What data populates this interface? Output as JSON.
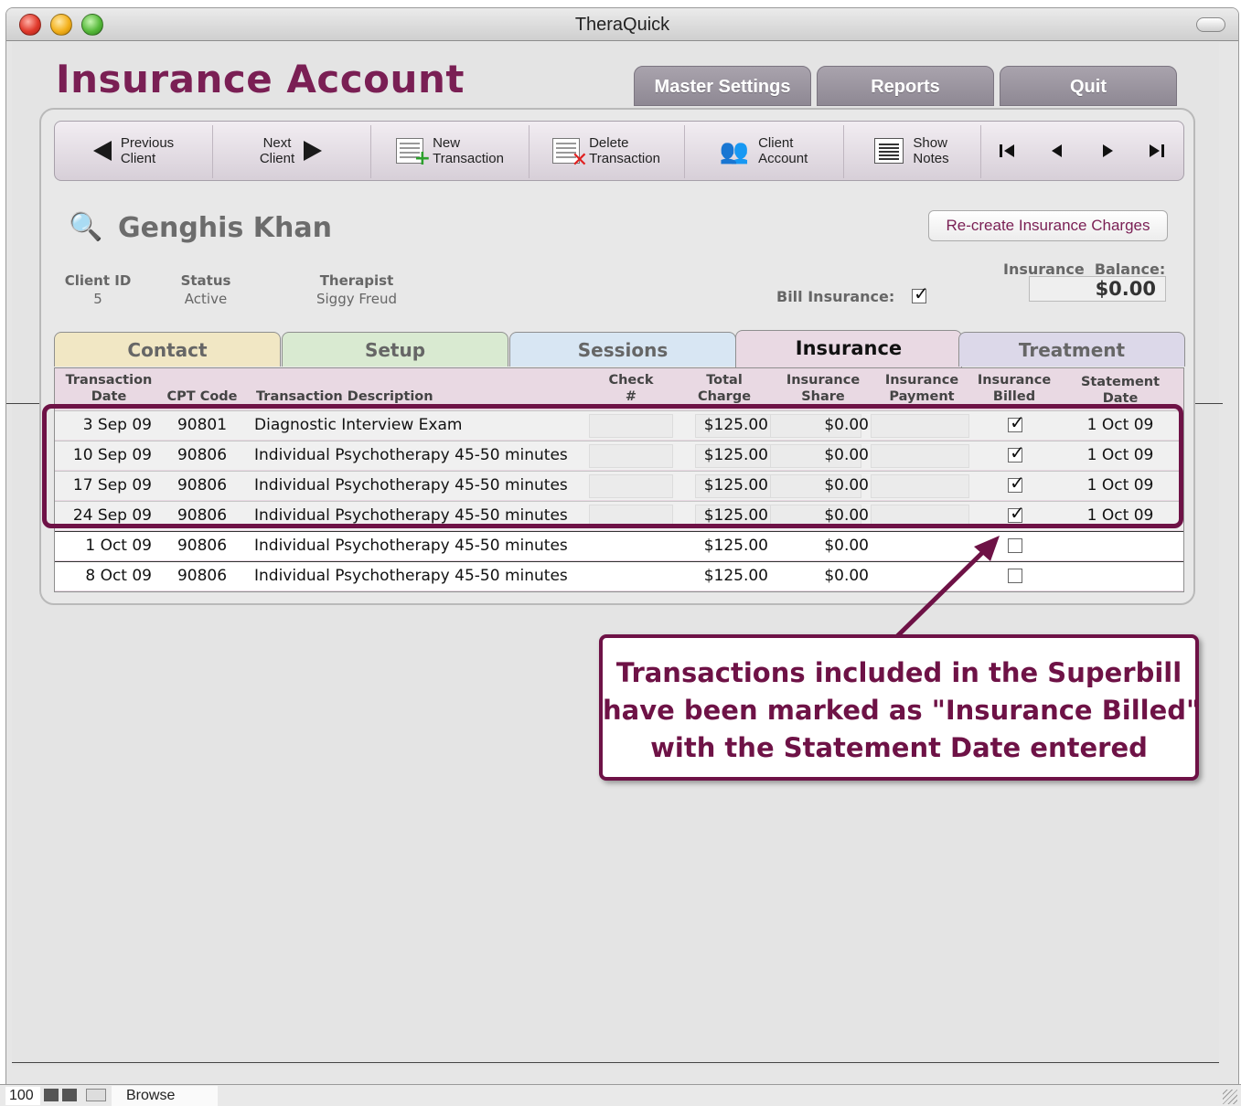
{
  "window": {
    "title": "TheraQuick"
  },
  "header": {
    "title": "Insurance Account"
  },
  "top_tabs": [
    {
      "label": "Master Settings"
    },
    {
      "label": "Reports"
    },
    {
      "label": "Quit"
    }
  ],
  "toolbar": {
    "previous_client": "Previous\nClient",
    "next_client": "Next\nClient",
    "new_transaction": "New\nTransaction",
    "delete_transaction": "Delete\nTransaction",
    "client_account": "Client\nAccount",
    "show_notes": "Show\nNotes"
  },
  "client": {
    "name": "Genghis Khan",
    "id_label": "Client ID",
    "id": "5",
    "status_label": "Status",
    "status": "Active",
    "therapist_label": "Therapist",
    "therapist": "Siggy Freud",
    "bill_insurance_label": "Bill Insurance:",
    "bill_insurance": true,
    "balance_label": "Insurance  Balance:",
    "balance": "$0.00",
    "recreate_button": "Re-create Insurance Charges"
  },
  "tabs": [
    {
      "label": "Contact",
      "color": "#f1e7c4"
    },
    {
      "label": "Setup",
      "color": "#d9ead1"
    },
    {
      "label": "Sessions",
      "color": "#d8e6f3"
    },
    {
      "label": "Insurance",
      "color": "#e9d9e3",
      "active": true
    },
    {
      "label": "Treatment",
      "color": "#dcd8e9"
    }
  ],
  "table": {
    "headers": {
      "date": "Transaction\nDate",
      "cpt": "CPT Code",
      "desc": "Transaction Description",
      "check": "Check\n#",
      "total": "Total\nCharge",
      "share": "Insurance\nShare",
      "payment": "Insurance\nPayment",
      "billed": "Insurance\nBilled",
      "stmt": "Statement\nDate"
    },
    "rows": [
      {
        "date": "3 Sep 09",
        "cpt": "90801",
        "desc": "Diagnostic Interview Exam",
        "total": "$125.00",
        "share": "$0.00",
        "billed": true,
        "stmt": "1 Oct 09"
      },
      {
        "date": "10 Sep 09",
        "cpt": "90806",
        "desc": "Individual Psychotherapy 45-50 minutes",
        "total": "$125.00",
        "share": "$0.00",
        "billed": true,
        "stmt": "1 Oct 09"
      },
      {
        "date": "17 Sep 09",
        "cpt": "90806",
        "desc": "Individual Psychotherapy 45-50 minutes",
        "total": "$125.00",
        "share": "$0.00",
        "billed": true,
        "stmt": "1 Oct 09"
      },
      {
        "date": "24 Sep 09",
        "cpt": "90806",
        "desc": "Individual Psychotherapy 45-50 minutes",
        "total": "$125.00",
        "share": "$0.00",
        "billed": true,
        "stmt": "1 Oct 09"
      },
      {
        "date": "1 Oct 09",
        "cpt": "90806",
        "desc": "Individual Psychotherapy 45-50 minutes",
        "total": "$125.00",
        "share": "$0.00",
        "billed": false,
        "stmt": ""
      },
      {
        "date": "8 Oct 09",
        "cpt": "90806",
        "desc": "Individual Psychotherapy 45-50 minutes",
        "total": "$125.00",
        "share": "$0.00",
        "billed": false,
        "stmt": ""
      }
    ]
  },
  "callout": {
    "line1": "Transactions included in the Superbill",
    "line2": "have been marked as \"Insurance Billed\"",
    "line3": "with the Statement Date entered"
  },
  "statusbar": {
    "zoom": "100",
    "mode": "Browse"
  },
  "colors": {
    "accent": "#7a1f54",
    "callout": "#6e1246"
  }
}
